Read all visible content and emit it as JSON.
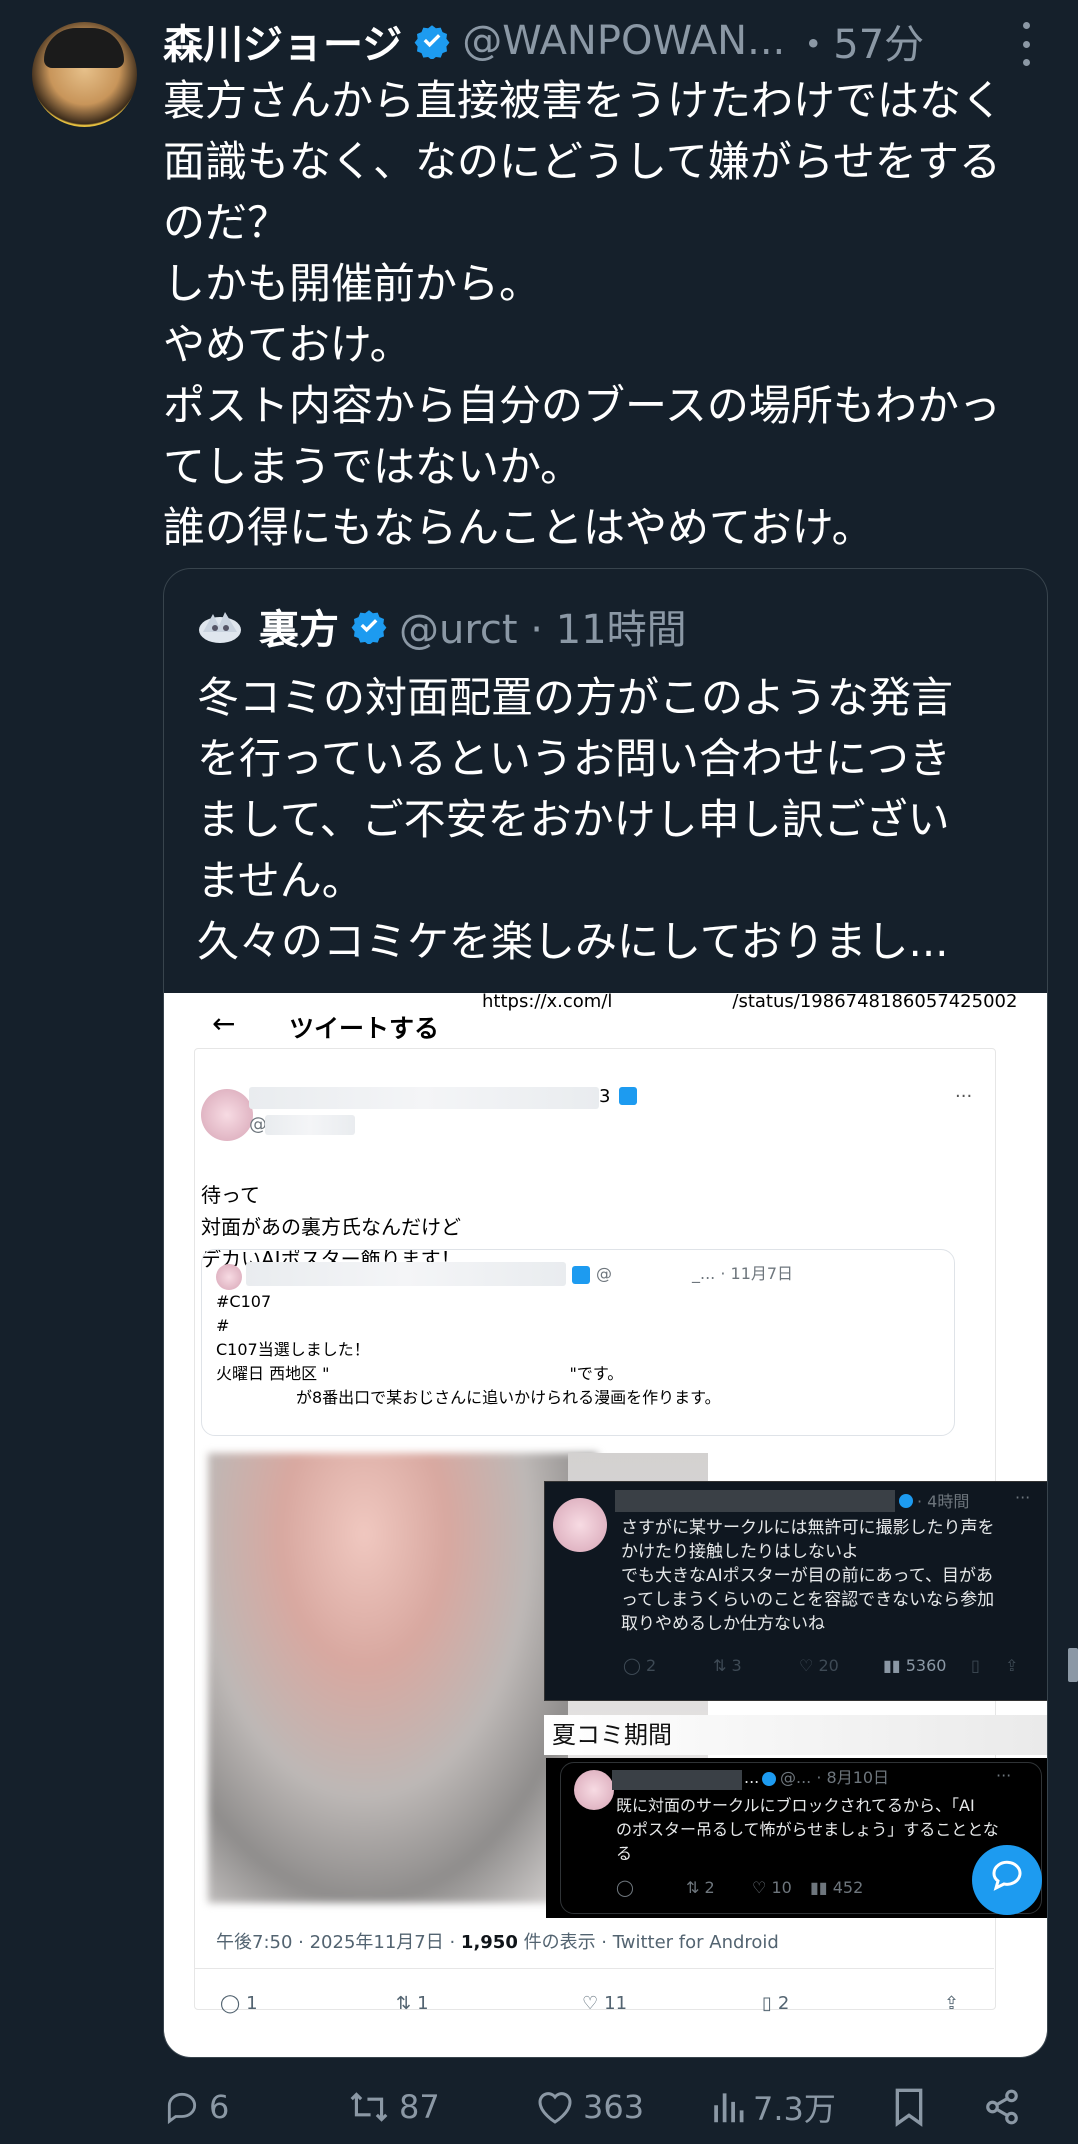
{
  "tweet": {
    "display_name": "森川ジョージ",
    "handle": "@WANPOWAN...",
    "time": "・57分",
    "lines": [
      "裏方さんから直接被害をうけたわけではなく",
      "面識もなく、なのにどうして嫌がらせをする",
      "のだ？",
      "しかも開催前から。",
      "やめておけ。",
      "ポスト内容から自分のブースの場所もわかっ",
      "てしまうではないか。",
      "誰の得にもならんことはやめておけ。"
    ]
  },
  "quote": {
    "display_name": "裏方",
    "handle_time": "@urct · 11時間",
    "lines": [
      "冬コミの対面配置の方がこのような発言",
      "を行っているというお問い合わせにつき",
      "まして、ご不安をおかけし申し訳ござい",
      "ません。",
      "久々のコミケを楽しみにしておりまし..."
    ]
  },
  "screenshot": {
    "url_left": "https://x.com/l",
    "url_right": "/status/1986748186057425002",
    "back": "←",
    "title": "ツイートする",
    "name_suffix": "3",
    "at": "@",
    "body_lines": [
      "待って",
      "対面があの裏方氏なんだけど",
      "デカいAIポスター飾ります！"
    ],
    "inner_meta": "@　　　　　_... · 11月7日",
    "inner_lines": [
      "#C107",
      "#",
      "C107当選しました！",
      "火曜日 西地区 \"　　　　　　　　　　　　　　　\"です。",
      "　　　　　が8番出口で某おじさんに追いかけられる漫画を作ります。"
    ],
    "reply1": {
      "time": "· 4時間",
      "lines": [
        "さすがに某サークルには無許可に撮影したり声を",
        "かけたり接触したりはしないよ",
        "でも大きなAIポスターが目の前にあって、目があ",
        "ってしまうくらいのことを容認できないなら参加",
        "取りやめるしか仕方ないね"
      ],
      "stats": [
        "2",
        "3",
        "20",
        "5360"
      ]
    },
    "summer_label": "夏コミ期間",
    "reply2": {
      "meta": "@... · 8月10日",
      "lines": [
        "既に対面のサークルにブロックされてるから、「AI",
        "のポスター吊るして怖がらせましょう」することとな",
        "る"
      ],
      "stats": [
        "",
        "2",
        "10",
        "452"
      ]
    },
    "meta_time": "午後7:50 · 2025年11月7日 · ",
    "meta_views": "1,950",
    "meta_rest": " 件の表示 · Twitter for Android",
    "stats": [
      "1",
      "1",
      "11",
      "2"
    ]
  },
  "actions": {
    "replies": "6",
    "retweets": "87",
    "likes": "363",
    "views": "7.3万"
  },
  "colors": {
    "background": "#15202b",
    "accent": "#1d9bf0",
    "muted": "#8b98a5"
  }
}
